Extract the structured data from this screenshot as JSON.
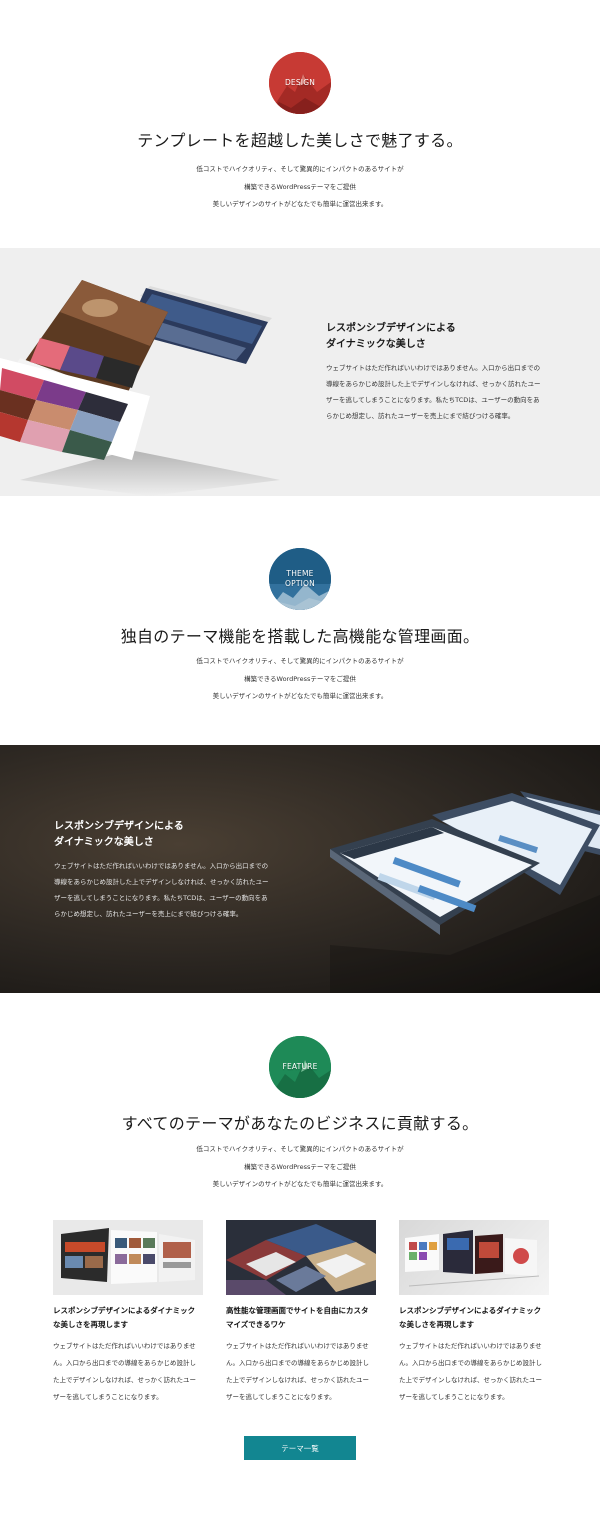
{
  "sections": [
    {
      "badge": "DESIGN",
      "headline": "テンプレートを超越した美しさで魅了する。",
      "lead": [
        "低コストでハイクオリティ、そして驚異的にインパクトのあるサイトが",
        "構築できるWordPressテーマをご提供",
        "美しいデザインのサイトがどなたでも簡単に運営出来ます。"
      ]
    },
    {
      "badge_line1": "THEME",
      "badge_line2": "OPTION",
      "headline": "独自のテーマ機能を搭載した高機能な管理画面。",
      "lead": [
        "低コストでハイクオリティ、そして驚異的にインパクトのあるサイトが",
        "構築できるWordPressテーマをご提供",
        "美しいデザインのサイトがどなたでも簡単に運営出来ます。"
      ]
    },
    {
      "badge": "FEATURE",
      "headline": "すべてのテーマがあなたのビジネスに貢献する。",
      "lead": [
        "低コストでハイクオリティ、そして驚異的にインパクトのあるサイトが",
        "構築できるWordPressテーマをご提供",
        "美しいデザインのサイトがどなたでも簡単に運営出来ます。"
      ]
    }
  ],
  "bands": [
    {
      "title": [
        "レスポンシブデザインによる",
        "ダイナミックな美しさ"
      ],
      "body": [
        "ウェブサイトはただ作ればいいわけではありません。入口から出口までの",
        "導線をあらかじめ設計した上でデザインしなければ、せっかく訪れたユー",
        "ザーを逃してしまうことになります。私たちTCDは、ユーザーの動向をあ",
        "らかじめ想定し、訪れたユーザーを売上にまで結びつける確率。"
      ]
    },
    {
      "title": [
        "レスポンシブデザインによる",
        "ダイナミックな美しさ"
      ],
      "body": [
        "ウェブサイトはただ作ればいいわけではありません。入口から出口までの",
        "導線をあらかじめ設計した上でデザインしなければ、せっかく訪れたユー",
        "ザーを逃してしまうことになります。私たちTCDは、ユーザーの動向をあ",
        "らかじめ想定し、訪れたユーザーを売上にまで結びつける確率。"
      ]
    }
  ],
  "cards": [
    {
      "title": [
        "レスポンシブデザインによるダイナミック",
        "な美しさを再現します"
      ],
      "body": [
        "ウェブサイトはただ作ればいいわけではありませ",
        "ん。入口から出口までの導線をあらかじめ設計し",
        "た上でデザインしなければ、せっかく訪れたユー",
        "ザーを逃してしまうことになります。"
      ]
    },
    {
      "title": [
        "高性能な管理画面でサイトを自由にカスタ",
        "マイズできるワケ"
      ],
      "body": [
        "ウェブサイトはただ作ればいいわけではありませ",
        "ん。入口から出口までの導線をあらかじめ設計し",
        "た上でデザインしなければ、せっかく訪れたユー",
        "ザーを逃してしまうことになります。"
      ]
    },
    {
      "title": [
        "レスポンシブデザインによるダイナミック",
        "な美しさを再現します"
      ],
      "body": [
        "ウェブサイトはただ作ればいいわけではありませ",
        "ん。入口から出口までの導線をあらかじめ設計し",
        "た上でデザインしなければ、せっかく訪れたユー",
        "ザーを逃してしまうことになります。"
      ]
    }
  ],
  "cta_label": "テーマ一覧",
  "colors": {
    "design_badge": "#c73a34",
    "theme_badge": "#1f5d86",
    "feature_badge": "#1e8a57",
    "band_light": "#efefef",
    "band_dark": "#2b2621",
    "cta": "#128691"
  }
}
